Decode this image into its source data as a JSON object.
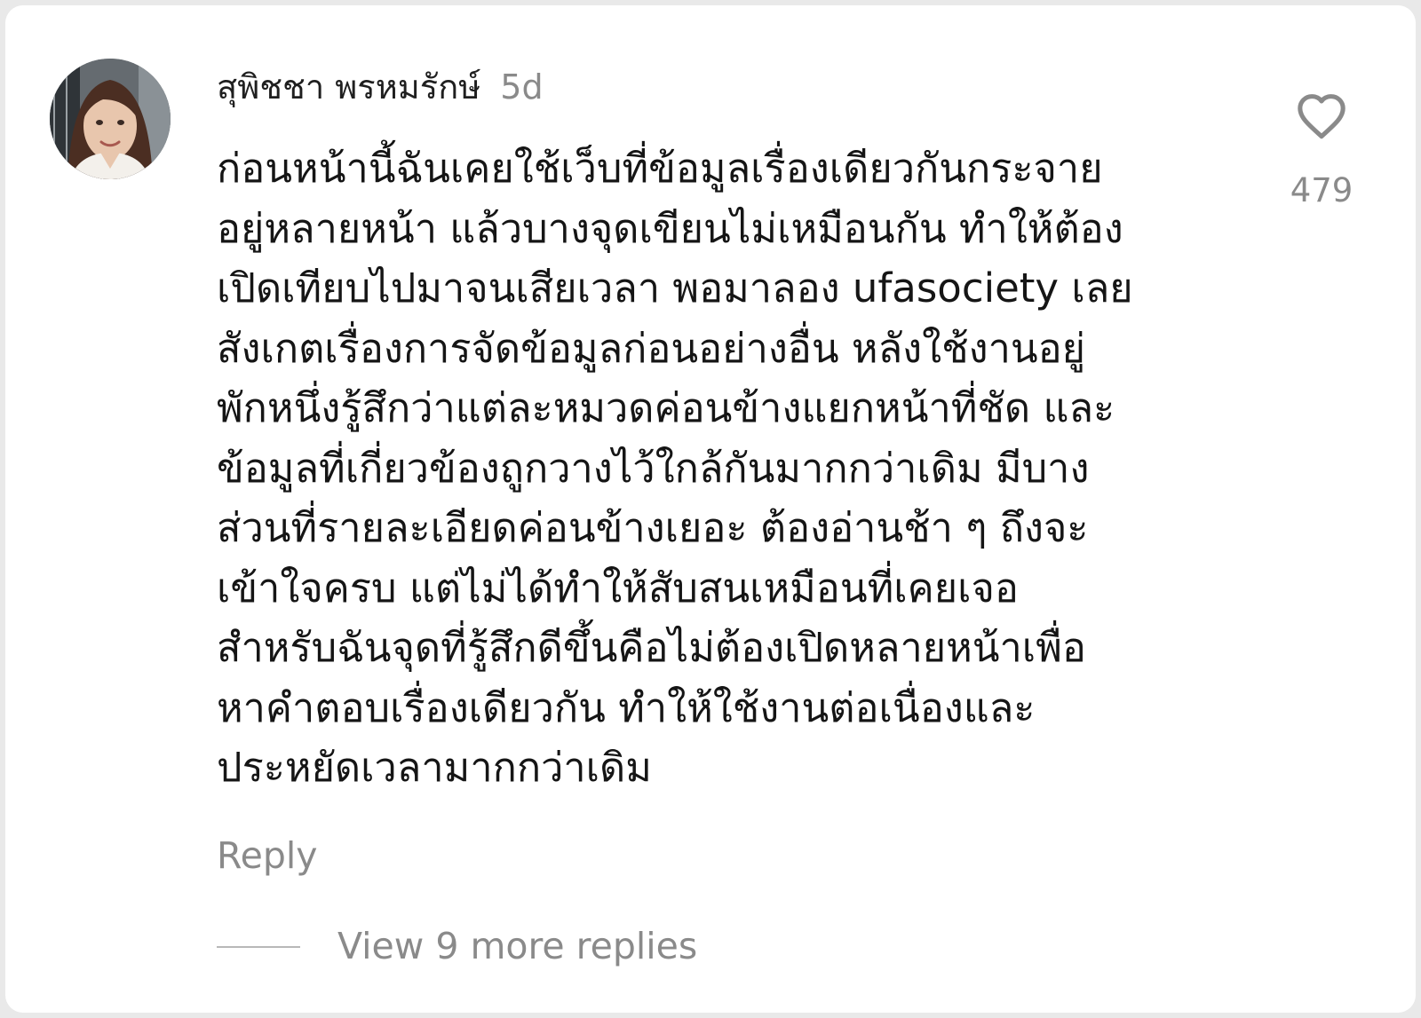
{
  "comment": {
    "username": "สุพิชชา พรหมรักษ์",
    "timestamp": "5d",
    "text_lines": [
      "ก่อนหน้านี้ฉันเคยใช้เว็บที่ข้อมูลเรื่องเดียวกันกระจาย",
      "อยู่หลายหน้า แล้วบางจุดเขียนไม่เหมือนกัน ทำให้ต้อง",
      "เปิดเทียบไปมาจนเสียเวลา พอมาลอง ufasociety เลย",
      "สังเกตเรื่องการจัดข้อมูลก่อนอย่างอื่น หลังใช้งานอยู่",
      "พักหนึ่งรู้สึกว่าแต่ละหมวดค่อนข้างแยกหน้าที่ชัด และ",
      "ข้อมูลที่เกี่ยวข้องถูกวางไว้ใกล้กันมากกว่าเดิม มีบาง",
      "ส่วนที่รายละเอียดค่อนข้างเยอะ ต้องอ่านช้า ๆ ถึงจะ",
      "เข้าใจครบ แต่ไม่ได้ทำให้สับสนเหมือนที่เคยเจอ",
      "สำหรับฉันจุดที่รู้สึกดีขึ้นคือไม่ต้องเปิดหลายหน้าเพื่อ",
      "หาคำตอบเรื่องเดียวกัน ทำให้ใช้งานต่อเนื่องและ",
      "ประหยัดเวลามากกว่าเดิม"
    ],
    "like_count": "479",
    "like_icon": "heart-outline-icon",
    "reply_label": "Reply",
    "view_more_label": "View 9 more replies"
  },
  "colors": {
    "background": "#ffffff",
    "text": "#151515",
    "muted": "#8a8a8a"
  }
}
